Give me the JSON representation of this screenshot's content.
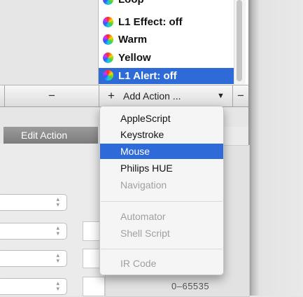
{
  "actions_list": {
    "items": [
      {
        "label": "Loop",
        "selected": false
      },
      {
        "label": "L1 Effect: off",
        "selected": false
      },
      {
        "label": "Warm",
        "selected": false
      },
      {
        "label": "Yellow",
        "selected": false
      },
      {
        "label": "L1 Alert: off",
        "selected": true
      }
    ],
    "icon": "color-wheel-icon"
  },
  "toolbar": {
    "remove_label": "−",
    "add_plus": "+",
    "add_action_label": "Add Action ...",
    "add_arrow": "▼",
    "remove_action_label": "−"
  },
  "tabs": {
    "edit_action": "Edit Action"
  },
  "fields": {
    "range_text": "0–65535"
  },
  "menu": {
    "items": [
      {
        "label": "AppleScript",
        "enabled": true,
        "highlighted": false
      },
      {
        "label": "Keystroke",
        "enabled": true,
        "highlighted": false
      },
      {
        "label": "Mouse",
        "enabled": true,
        "highlighted": true
      },
      {
        "label": "Philips HUE",
        "enabled": true,
        "highlighted": false
      },
      {
        "label": "Navigation",
        "enabled": false,
        "highlighted": false
      },
      {
        "label": "Automator",
        "enabled": false,
        "highlighted": false
      },
      {
        "label": "Shell Script",
        "enabled": false,
        "highlighted": false
      },
      {
        "label": "IR Code",
        "enabled": false,
        "highlighted": false
      }
    ]
  },
  "colors": {
    "selection": "#2f6bd8",
    "disabled_text": "#a0a0a0"
  }
}
